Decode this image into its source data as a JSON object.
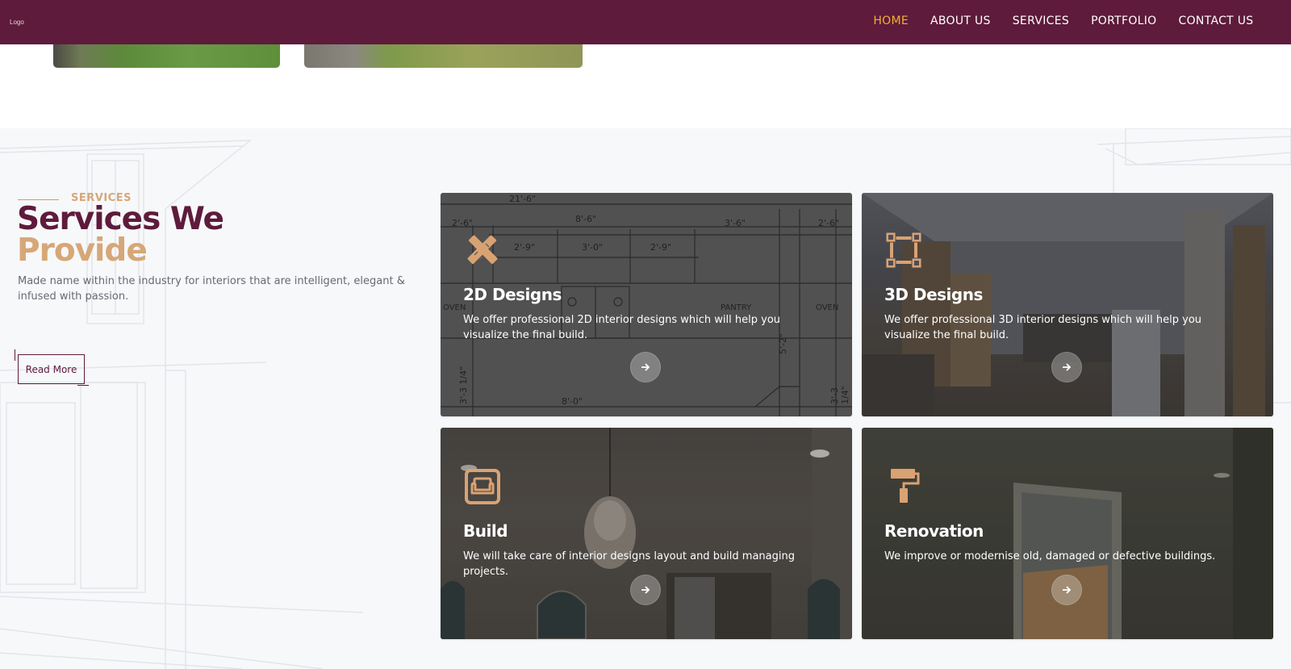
{
  "header": {
    "logo_text": "Logo",
    "nav": [
      {
        "label": "HOME",
        "active": true
      },
      {
        "label": "ABOUT US",
        "active": false
      },
      {
        "label": "SERVICES",
        "active": false
      },
      {
        "label": "PORTFOLIO",
        "active": false
      },
      {
        "label": "CONTACT US",
        "active": false
      }
    ]
  },
  "services": {
    "eyebrow": "SERVICES",
    "title_line1": "Services We",
    "title_line2": "Provide",
    "description": "Made name within the industry for interiors that are intelligent, elegant & infused with passion.",
    "read_more_label": "Read More",
    "cards": [
      {
        "title": "2D Designs",
        "description": "We offer professional 2D interior designs which will help you visualize the final build.",
        "icon": "pencil-ruler-icon"
      },
      {
        "title": "3D Designs",
        "description": "We offer professional 3D interior designs which will help you visualize the final build.",
        "icon": "vector-square-icon"
      },
      {
        "title": "Build",
        "description": "We will take care of interior designs layout and build managing projects.",
        "icon": "couch-icon"
      },
      {
        "title": "Renovation",
        "description": "We improve or modernise old, damaged or defective buildings.",
        "icon": "paint-roller-icon"
      }
    ]
  },
  "blueprint_labels": {
    "dims": [
      "21'-6\"",
      "2'-6\"",
      "8'-6\"",
      "3'-6\"",
      "2'-6\"",
      "2'-9\"",
      "3'-0\"",
      "2'-9\"",
      "8'-0\""
    ],
    "rooms": [
      "OVEN",
      "PANTRY",
      "OVEN"
    ],
    "vertical": [
      "5'-2\"",
      "3'-3 1/4\"",
      "3'-3 1/4\""
    ]
  },
  "colors": {
    "brand": "#5e1b3b",
    "accent": "#d6a777",
    "active_nav": "#f2b033"
  }
}
